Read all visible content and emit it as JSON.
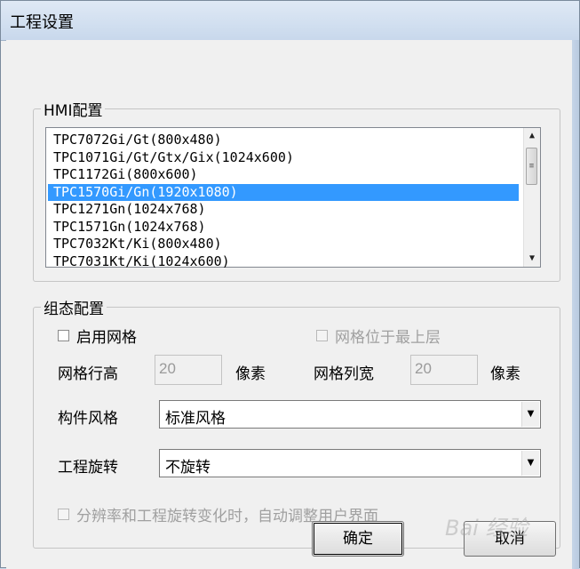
{
  "window": {
    "title": "工程设置"
  },
  "hmi_group": {
    "legend": "HMI配置",
    "items": [
      "TPC7072Gi/Gt(800x480)",
      "TPC1071Gi/Gt/Gtx/Gix(1024x600)",
      "TPC1172Gi(800x600)",
      "TPC1570Gi/Gn(1920x1080)",
      "TPC1271Gn(1024x768)",
      "TPC1571Gn(1024x768)",
      "TPC7032Kt/Ki(800x480)",
      "TPC7031Kt/Ki(1024x600)"
    ],
    "selected_index": 3
  },
  "config_group": {
    "legend": "组态配置",
    "enable_grid": {
      "label": "启用网格",
      "checked": false
    },
    "grid_on_top": {
      "label": "网格位于最上层",
      "checked": false,
      "disabled": true
    },
    "row_height": {
      "label": "网格行高",
      "value": "20",
      "unit": "像素"
    },
    "col_width": {
      "label": "网格列宽",
      "value": "20",
      "unit": "像素"
    },
    "component_style": {
      "label": "构件风格",
      "value": "标准风格"
    },
    "project_rotation": {
      "label": "工程旋转",
      "value": "不旋转"
    },
    "auto_adjust": {
      "label": "分辨率和工程旋转变化时，自动调整用户界面",
      "checked": false,
      "disabled": true
    }
  },
  "buttons": {
    "ok": "确定",
    "cancel": "取消"
  },
  "watermark": "Bai 经验"
}
